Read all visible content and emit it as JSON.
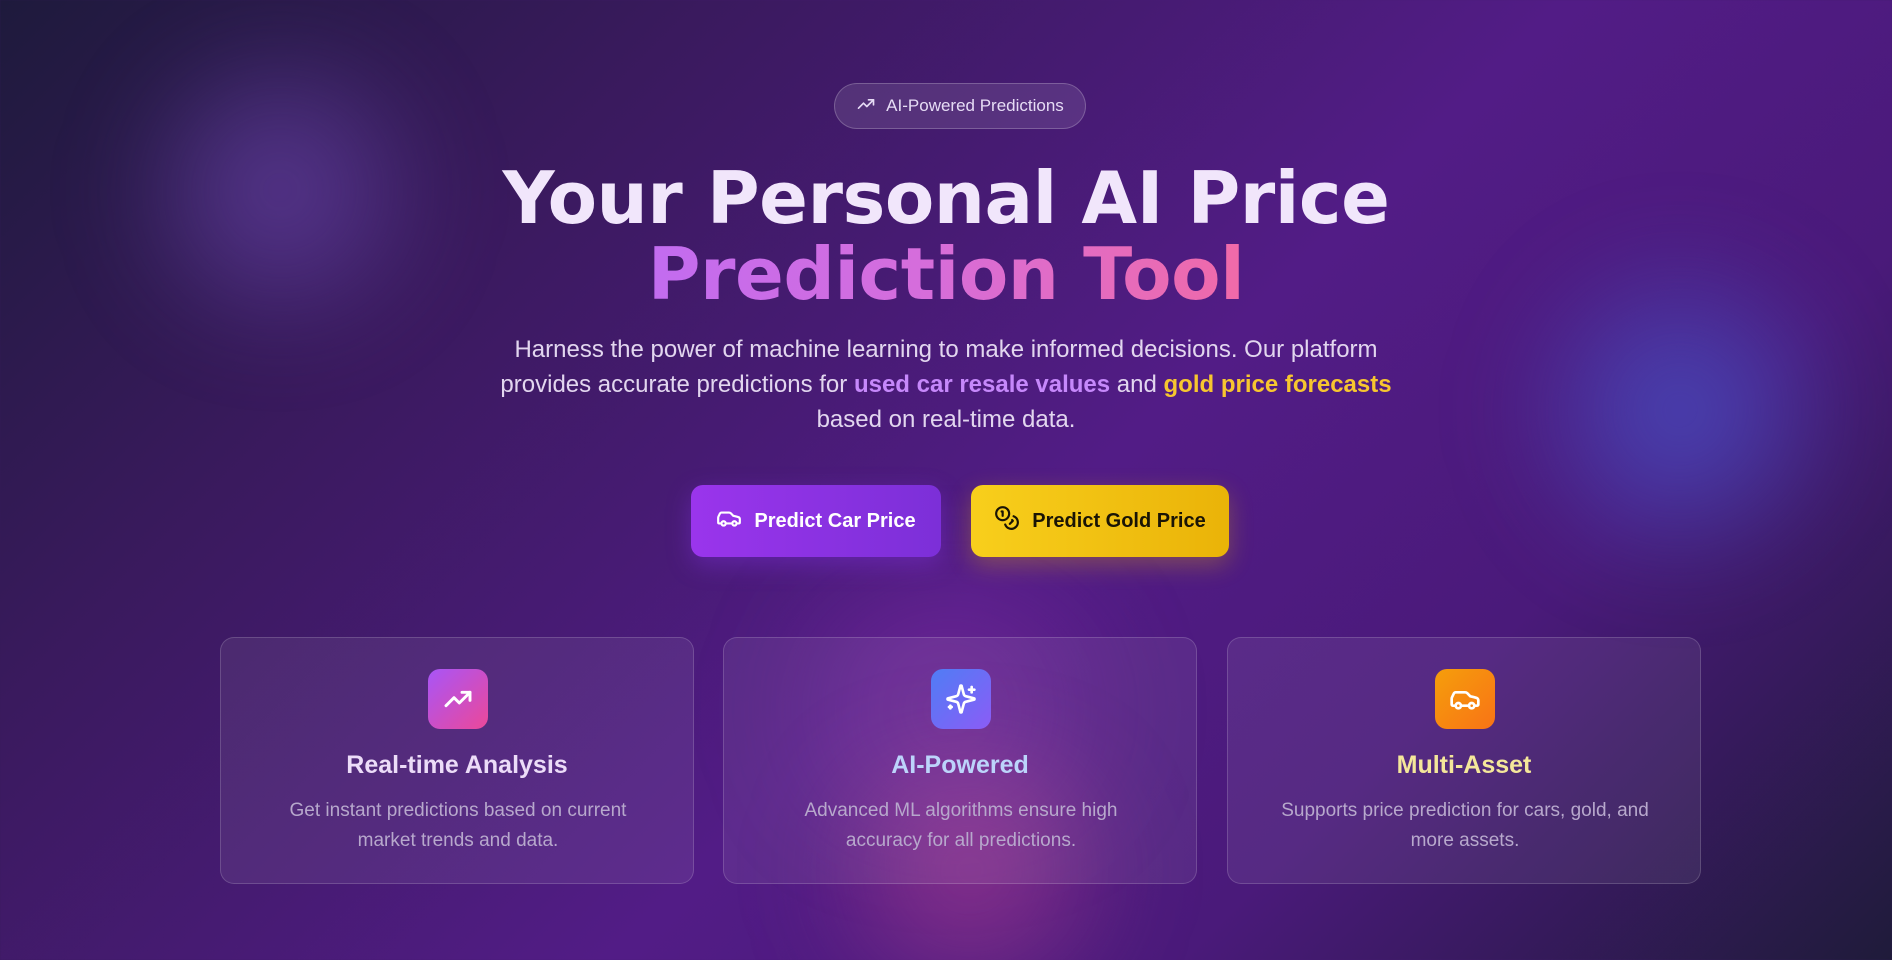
{
  "badge": {
    "label": "AI-Powered Predictions",
    "icon": "trending-up-icon"
  },
  "hero": {
    "title_line1": "Your Personal AI Price",
    "title_line2": "Prediction Tool",
    "desc_part1": "Harness the power of machine learning to make informed decisions. Our platform provides accurate predictions for ",
    "desc_highlight1": "used car resale values",
    "desc_part2": " and ",
    "desc_highlight2": "gold price forecasts",
    "desc_part3": " based on real-time data."
  },
  "buttons": {
    "car": {
      "label": "Predict Car Price",
      "icon": "car-icon"
    },
    "gold": {
      "label": "Predict Gold Price",
      "icon": "coins-icon"
    }
  },
  "features": [
    {
      "title": "Real-time Analysis",
      "text": "Get instant predictions based on current market trends and data.",
      "icon": "trending-up-icon"
    },
    {
      "title": "AI-Powered",
      "text": "Advanced ML algorithms ensure high accuracy for all predictions.",
      "icon": "sparkles-icon"
    },
    {
      "title": "Multi-Asset",
      "text": "Supports price prediction for cars, gold, and more assets.",
      "icon": "car-icon"
    }
  ],
  "colors": {
    "accent_purple": "#9a35ec",
    "accent_gold": "#f8cf1c",
    "highlight_purple": "#c688fb",
    "highlight_gold": "#f7c62f"
  }
}
